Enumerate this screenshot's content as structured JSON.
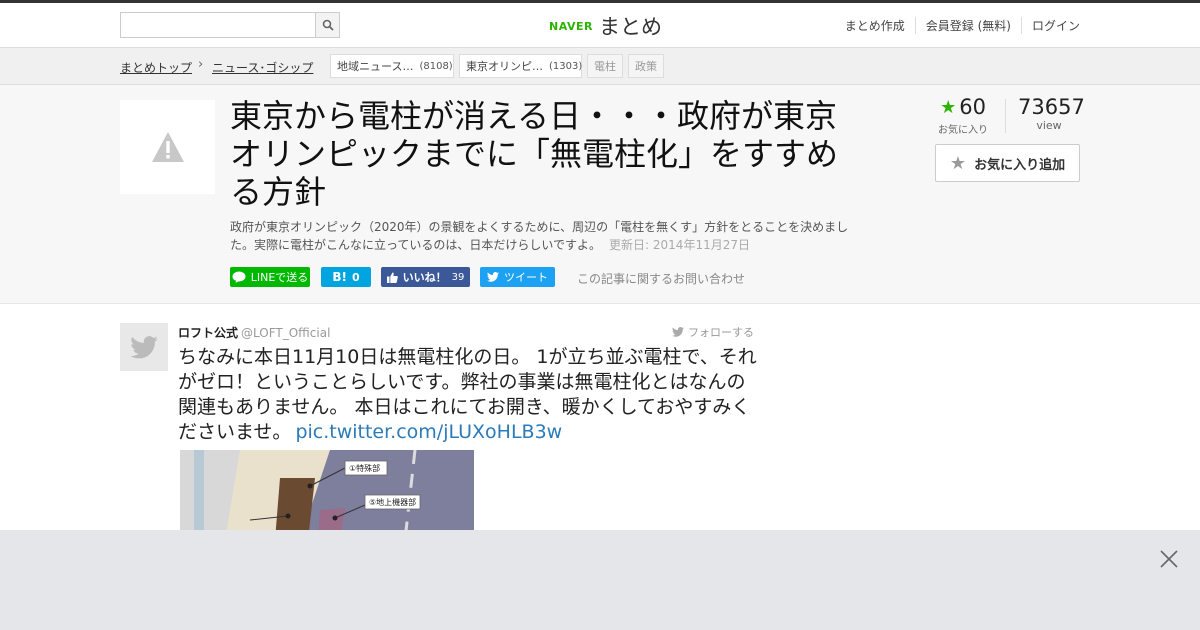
{
  "header": {
    "search_placeholder": "",
    "logo_naver": "NAVER",
    "logo_matome": "まとめ",
    "links": [
      "まとめ作成",
      "会員登録 (無料)",
      "ログイン"
    ]
  },
  "breadcrumb": {
    "items": [
      "まとめトップ",
      "ニュース･ゴシップ"
    ]
  },
  "tags": [
    {
      "label": "地域ニュース…",
      "count": "(8108)"
    },
    {
      "label": "東京オリンピ…",
      "count": "(1303)"
    },
    {
      "label": "電柱",
      "count": ""
    },
    {
      "label": "政策",
      "count": ""
    }
  ],
  "article": {
    "title": "東京から電柱が消える日・・・政府が東京オリンピックまでに「無電柱化」をすすめる方針",
    "description": "政府が東京オリンピック（2020年）の景観をよくするために、周辺の「電柱を無くす」方針をとることを決めました。実際に電柱がこんなに立っているのは、日本だけらしいですよ。",
    "updated": "更新日: 2014年11月27日",
    "favorites": "60",
    "favorites_label": "お気に入り",
    "views": "73657",
    "views_label": "view",
    "fav_button": "お気に入り追加",
    "contact": "この記事に関するお問い合わせ"
  },
  "share": {
    "line": "LINEで送る",
    "hatena_count": "0",
    "facebook_label": "いいね！",
    "facebook_count": "39",
    "tweet": "ツイート"
  },
  "tweet": {
    "name": "ロフト公式",
    "handle": "@LOFT_Official",
    "follow": "フォローする",
    "text": "ちなみに本日11月10日は無電柱化の日。 1が立ち並ぶ電柱で、それがゼロ！ということらしいです。弊社の事業は無電柱化とはなんの関連もありません。 本日はこれにてお開き、暖かくしておやすみくださいませ。",
    "link": "pic.twitter.com/jLUXoHLB3w",
    "image_labels": [
      "①特殊部",
      "⑤地上機器部"
    ]
  },
  "colors": {
    "brand": "#2db400",
    "line": "#00b900",
    "hatena": "#00a4de",
    "facebook": "#3b5998",
    "twitter": "#1da1f2",
    "link": "#2b7bb9"
  }
}
